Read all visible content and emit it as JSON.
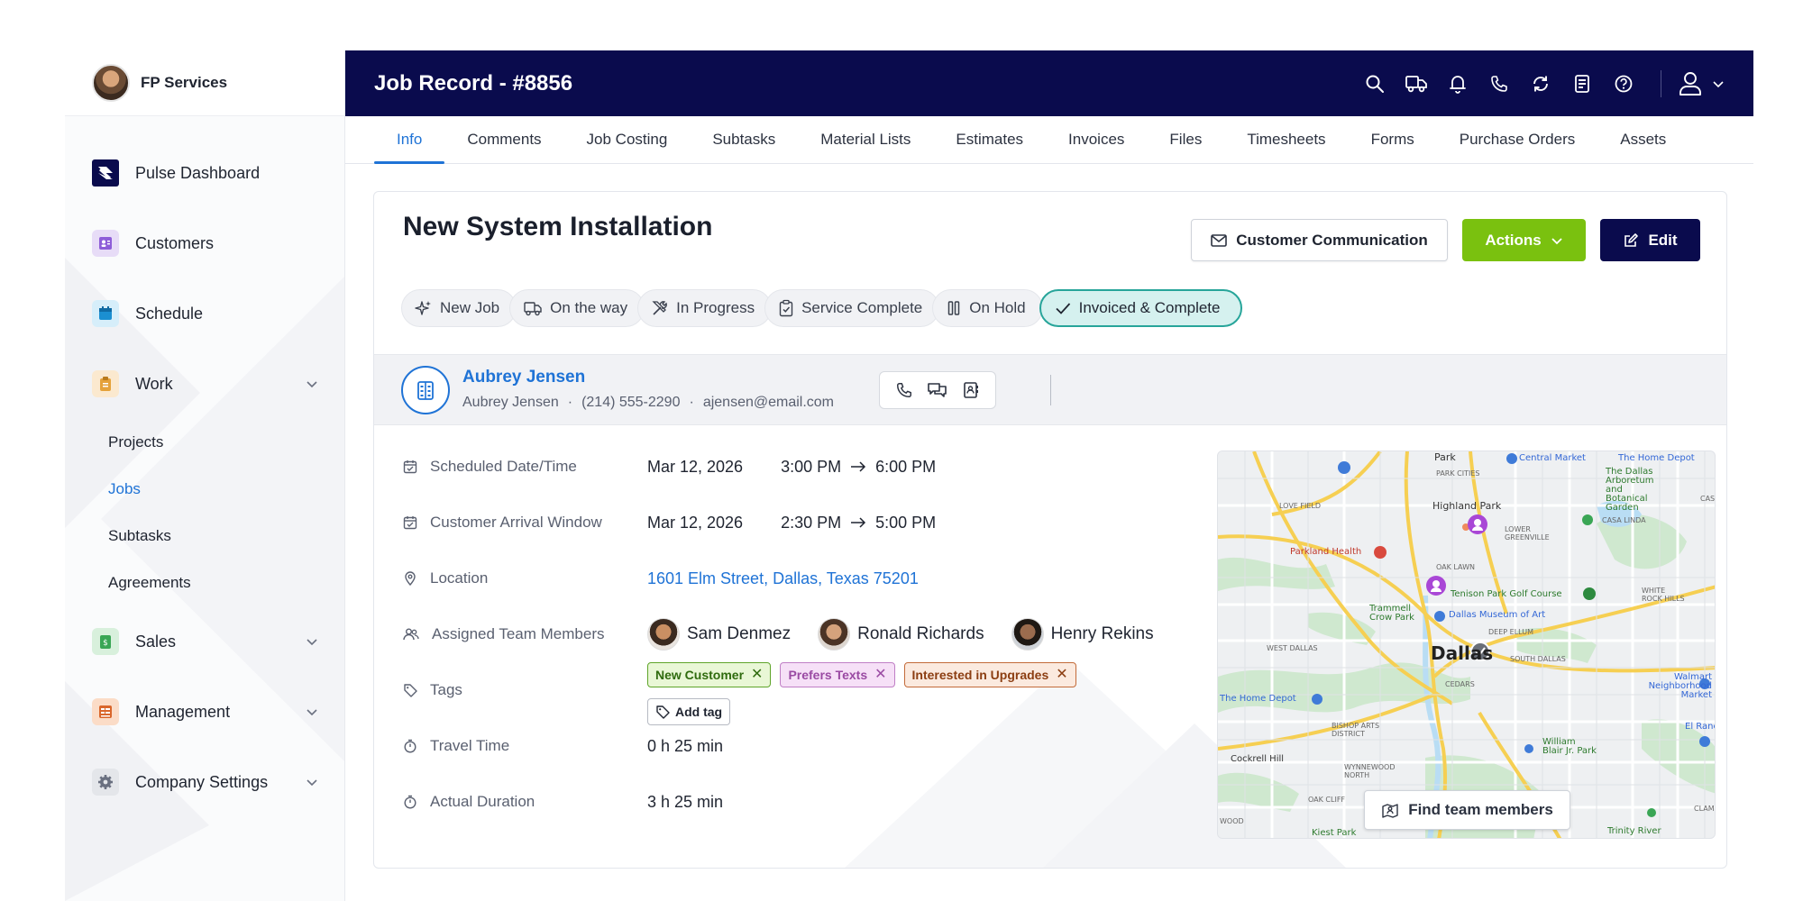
{
  "sidebar": {
    "brand": "FP Services",
    "items": [
      {
        "label": "Pulse Dashboard"
      },
      {
        "label": "Customers"
      },
      {
        "label": "Schedule"
      },
      {
        "label": "Work"
      },
      {
        "label": "Sales"
      },
      {
        "label": "Management"
      },
      {
        "label": "Company Settings"
      }
    ],
    "work_subitems": [
      "Projects",
      "Jobs",
      "Subtasks",
      "Agreements"
    ],
    "active_subitem": "Jobs"
  },
  "header": {
    "title": "Job Record - #8856",
    "icons": [
      "search-icon",
      "truck-icon",
      "bell-icon",
      "phone-icon",
      "refresh-icon",
      "receipt-icon",
      "help-icon",
      "user-icon"
    ]
  },
  "tabs": [
    "Info",
    "Comments",
    "Job Costing",
    "Subtasks",
    "Material Lists",
    "Estimates",
    "Invoices",
    "Files",
    "Timesheets",
    "Forms",
    "Purchase Orders",
    "Assets"
  ],
  "active_tab": "Info",
  "job": {
    "title": "New System Installation",
    "buttons": {
      "communication": "Customer Communication",
      "actions": "Actions",
      "edit": "Edit"
    },
    "statuses": [
      "New Job",
      "On the way",
      "In Progress",
      "Service Complete",
      "On Hold",
      "Invoiced & Complete"
    ],
    "current_status": "Invoiced & Complete"
  },
  "customer": {
    "name": "Aubrey Jensen",
    "contact_name": "Aubrey Jensen",
    "phone": "(214) 555-2290",
    "email": "ajensen@email.com",
    "separator": "·"
  },
  "details": {
    "scheduled": {
      "label": "Scheduled Date/Time",
      "date": "Mar 12, 2026",
      "start": "3:00 PM",
      "end": "6:00 PM"
    },
    "arrival": {
      "label": "Customer Arrival Window",
      "date": "Mar 12, 2026",
      "start": "2:30 PM",
      "end": "5:00 PM"
    },
    "location": {
      "label": "Location",
      "value": "1601 Elm Street, Dallas, Texas 75201"
    },
    "team": {
      "label": "Assigned Team Members",
      "members": [
        "Sam Denmez",
        "Ronald Richards",
        "Henry Rekins"
      ]
    },
    "tags": {
      "label": "Tags",
      "items": [
        "New Customer",
        "Prefers Texts",
        "Interested in Upgrades"
      ],
      "add_label": "Add tag"
    },
    "travel": {
      "label": "Travel Time",
      "value": "0 h 25 min"
    },
    "duration": {
      "label": "Actual Duration",
      "value": "3 h 25 min"
    }
  },
  "map": {
    "find_button": "Find team members",
    "labels": {
      "dallas": "Dallas",
      "park": "Park",
      "park_cities": "PARK CITIES",
      "central_market": "Central Market",
      "home_depot_top": "The Home Depot",
      "arboretum": "The Dallas Arboretum and Botanical Garden",
      "love_field": "LOVE FIELD",
      "highland_park": "Highland Park",
      "lower_greenville": "LOWER GREENVILLE",
      "casa_linda": "CASA LINDA",
      "parkland": "Parkland Health",
      "oak_lawn": "OAK LAWN",
      "tenison": "Tenison Park Golf Course",
      "white_rock": "WHITE ROCK HILLS",
      "trammell": "Trammell Crow Park",
      "dma": "Dallas Museum of Art",
      "deep_ellum": "DEEP ELLUM",
      "west_dallas": "WEST DALLAS",
      "south_dallas": "SOUTH DALLAS",
      "cedars": "CEDARS",
      "walmart": "Walmart Neighborhood Market",
      "home_depot_left": "The Home Depot",
      "bishop_arts": "BISHOP ARTS DISTRICT",
      "el_rancho": "El Ranc",
      "william_blair": "William Blair Jr. Park",
      "cockrell": "Cockrell Hill",
      "wynnewood": "WYNNEWOOD NORTH",
      "oak_cliff": "OAK CLIFF",
      "kiest": "Kiest Park",
      "trinity": "Trinity River",
      "woo": "WOOD",
      "cas": "CAS",
      "clam": "CLAM"
    }
  },
  "colors": {
    "navy": "#0a0b4d",
    "accent_blue": "#1f73d6",
    "actions_green": "#7ac10f",
    "status_teal": "#27a59a"
  }
}
